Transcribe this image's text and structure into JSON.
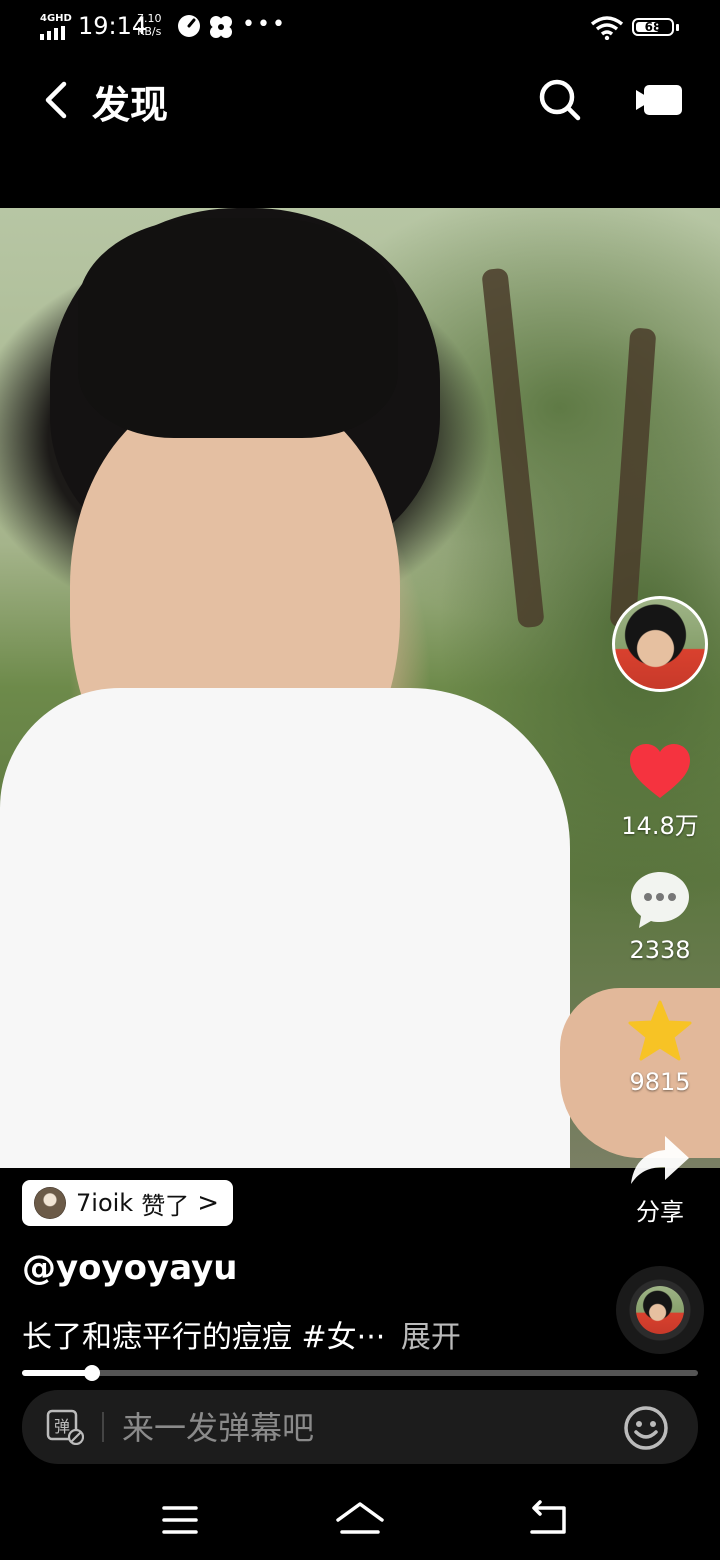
{
  "status_bar": {
    "network": "4GHD",
    "time": "19:14",
    "speed_value": "7.10",
    "speed_unit": "KB/s",
    "battery": "68",
    "battery_level": 0.68
  },
  "header": {
    "title": "发现"
  },
  "actions": {
    "likes": "14.8万",
    "comments": "2338",
    "favorites": "9815",
    "share_label": "分享"
  },
  "liked_by": {
    "user": "7ioik",
    "action": "赞了",
    "chevron": ">"
  },
  "post": {
    "username": "@yoyoyayu",
    "caption": "长了和痣平行的痘痘 #女···",
    "expand_label": "展开"
  },
  "progress": {
    "fraction": 0.104
  },
  "danmaku": {
    "placeholder": "来一发弹幕吧",
    "toggle_glyph": "弹"
  },
  "colors": {
    "like": "#f5333f",
    "favorite": "#f7c325",
    "background": "#000000"
  }
}
